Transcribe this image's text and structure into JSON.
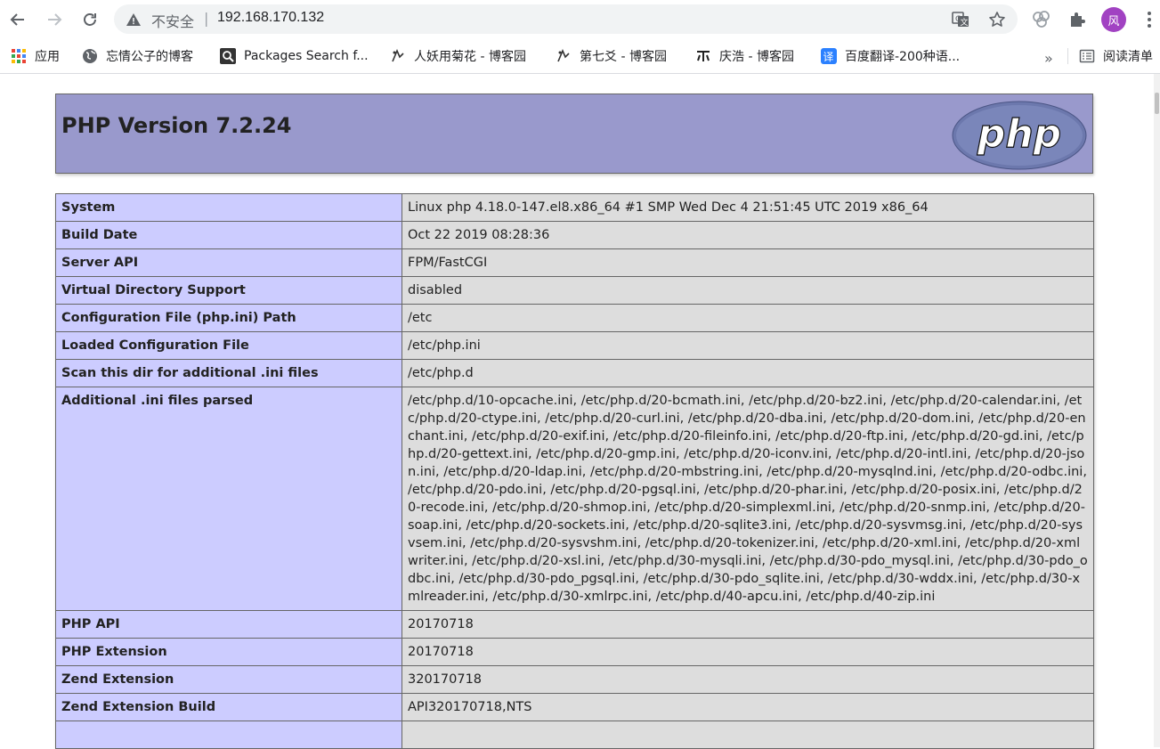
{
  "browser": {
    "omnibox": {
      "security_label": "不安全",
      "separator": "|",
      "url": "192.168.170.132"
    },
    "profile_initial": "风",
    "icons": [
      "back-icon",
      "forward-icon",
      "reload-icon",
      "warning-icon",
      "translate-icon",
      "star-icon",
      "extension-manager-icon",
      "puzzle-icon",
      "menu-icon"
    ]
  },
  "bookmarks": {
    "items": [
      {
        "label": "应用",
        "icon": "apps-grid-icon"
      },
      {
        "label": "忘情公子的博客",
        "icon": "globe-icon"
      },
      {
        "label": "Packages Search f...",
        "icon": "search-icon"
      },
      {
        "label": "人妖用菊花 - 博客园",
        "icon": "cnblogs-icon"
      },
      {
        "label": "第七爻 - 博客园",
        "icon": "cnblogs-icon"
      },
      {
        "label": "庆浩 - 博客园",
        "icon": "cnblogs-icon"
      },
      {
        "label": "百度翻译-200种语...",
        "icon": "baidu-translate-icon"
      }
    ],
    "overflow": "»",
    "reading_list": "阅读清单"
  },
  "phpinfo": {
    "title": "PHP Version 7.2.24",
    "logo_text": "php",
    "colors": {
      "header": "#9999cc",
      "key_cell": "#ccccff",
      "value_cell": "#dddddd"
    },
    "rows": [
      {
        "key": "System",
        "value": "Linux php 4.18.0-147.el8.x86_64 #1 SMP Wed Dec 4 21:51:45 UTC 2019 x86_64"
      },
      {
        "key": "Build Date",
        "value": "Oct 22 2019 08:28:36"
      },
      {
        "key": "Server API",
        "value": "FPM/FastCGI"
      },
      {
        "key": "Virtual Directory Support",
        "value": "disabled"
      },
      {
        "key": "Configuration File (php.ini) Path",
        "value": "/etc"
      },
      {
        "key": "Loaded Configuration File",
        "value": "/etc/php.ini"
      },
      {
        "key": "Scan this dir for additional .ini files",
        "value": "/etc/php.d"
      },
      {
        "key": "Additional .ini files parsed",
        "value": "/etc/php.d/10-opcache.ini, /etc/php.d/20-bcmath.ini, /etc/php.d/20-bz2.ini, /etc/php.d/20-calendar.ini, /etc/php.d/20-ctype.ini, /etc/php.d/20-curl.ini, /etc/php.d/20-dba.ini, /etc/php.d/20-dom.ini, /etc/php.d/20-enchant.ini, /etc/php.d/20-exif.ini, /etc/php.d/20-fileinfo.ini, /etc/php.d/20-ftp.ini, /etc/php.d/20-gd.ini, /etc/php.d/20-gettext.ini, /etc/php.d/20-gmp.ini, /etc/php.d/20-iconv.ini, /etc/php.d/20-intl.ini, /etc/php.d/20-json.ini, /etc/php.d/20-ldap.ini, /etc/php.d/20-mbstring.ini, /etc/php.d/20-mysqlnd.ini, /etc/php.d/20-odbc.ini, /etc/php.d/20-pdo.ini, /etc/php.d/20-pgsql.ini, /etc/php.d/20-phar.ini, /etc/php.d/20-posix.ini, /etc/php.d/20-recode.ini, /etc/php.d/20-shmop.ini, /etc/php.d/20-simplexml.ini, /etc/php.d/20-snmp.ini, /etc/php.d/20-soap.ini, /etc/php.d/20-sockets.ini, /etc/php.d/20-sqlite3.ini, /etc/php.d/20-sysvmsg.ini, /etc/php.d/20-sysvsem.ini, /etc/php.d/20-sysvshm.ini, /etc/php.d/20-tokenizer.ini, /etc/php.d/20-xml.ini, /etc/php.d/20-xmlwriter.ini, /etc/php.d/20-xsl.ini, /etc/php.d/30-mysqli.ini, /etc/php.d/30-pdo_mysql.ini, /etc/php.d/30-pdo_odbc.ini, /etc/php.d/30-pdo_pgsql.ini, /etc/php.d/30-pdo_sqlite.ini, /etc/php.d/30-wddx.ini, /etc/php.d/30-xmlreader.ini, /etc/php.d/30-xmlrpc.ini, /etc/php.d/40-apcu.ini, /etc/php.d/40-zip.ini"
      },
      {
        "key": "PHP API",
        "value": "20170718"
      },
      {
        "key": "PHP Extension",
        "value": "20170718"
      },
      {
        "key": "Zend Extension",
        "value": "320170718"
      },
      {
        "key": "Zend Extension Build",
        "value": "API320170718,NTS"
      },
      {
        "key": "",
        "value": ""
      }
    ]
  }
}
